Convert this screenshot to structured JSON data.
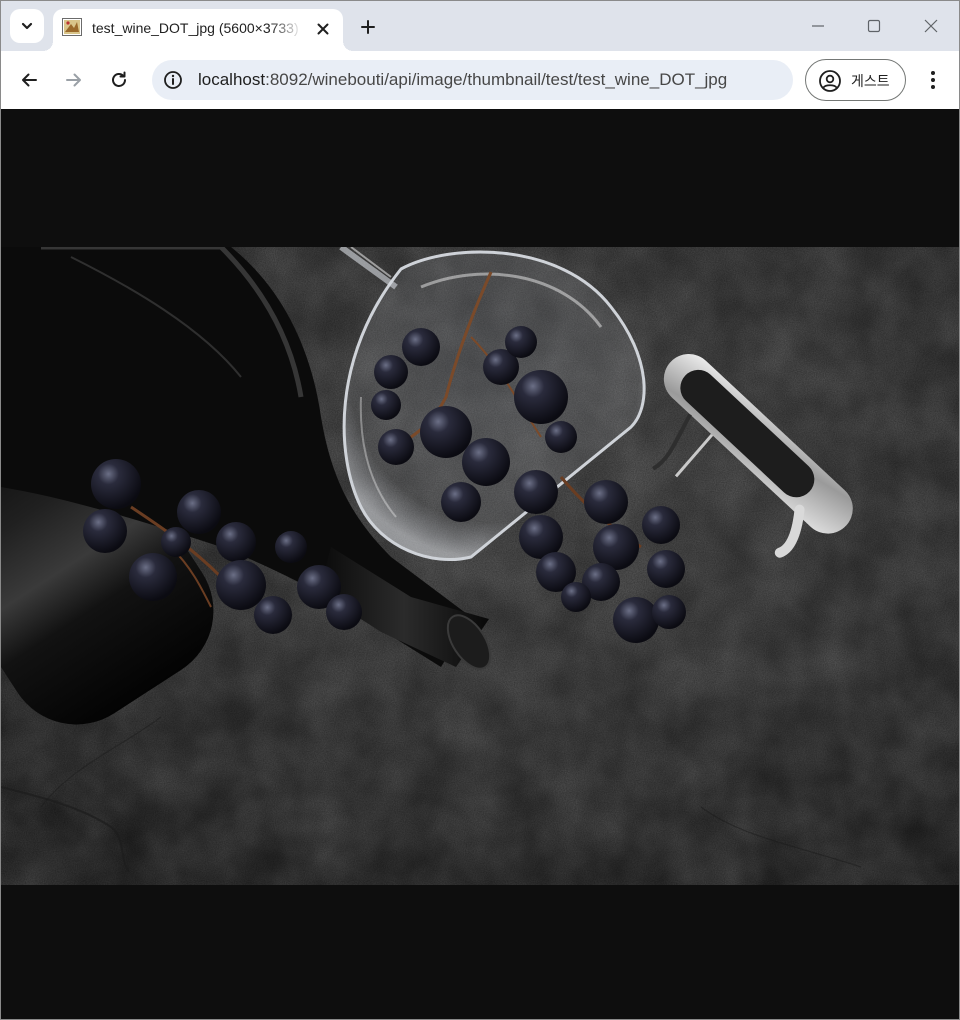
{
  "browser": {
    "tab": {
      "title": "test_wine_DOT_jpg (5600×3733)",
      "favicon": "image-file-icon"
    },
    "address_bar": {
      "host": "localhost",
      "path": ":8092/winebouti/api/image/thumbnail/test/test_wine_DOT_jpg"
    },
    "profile": {
      "label": "게스트"
    },
    "icons": {
      "tab_search": "chevron-down-icon",
      "close_tab": "close-icon",
      "new_tab": "plus-icon",
      "back": "arrow-left-icon",
      "forward": "arrow-right-icon",
      "reload": "reload-icon",
      "site_info": "info-icon",
      "profile": "person-icon",
      "menu": "kebab-menu-icon",
      "minimize": "minimize-icon",
      "maximize": "maximize-icon",
      "close_window": "close-icon"
    }
  },
  "content": {
    "image": {
      "description_tokens": [
        "wine-bottle",
        "wine-glass",
        "grapes",
        "corkscrew",
        "dark-concrete-surface"
      ],
      "native_size": "5600×3733",
      "background_color": "#0e0e0e"
    }
  },
  "colors": {
    "tabstrip": "#dfe3eb",
    "omnibox": "#e9eef6",
    "viewport": "#0e0e0e"
  }
}
